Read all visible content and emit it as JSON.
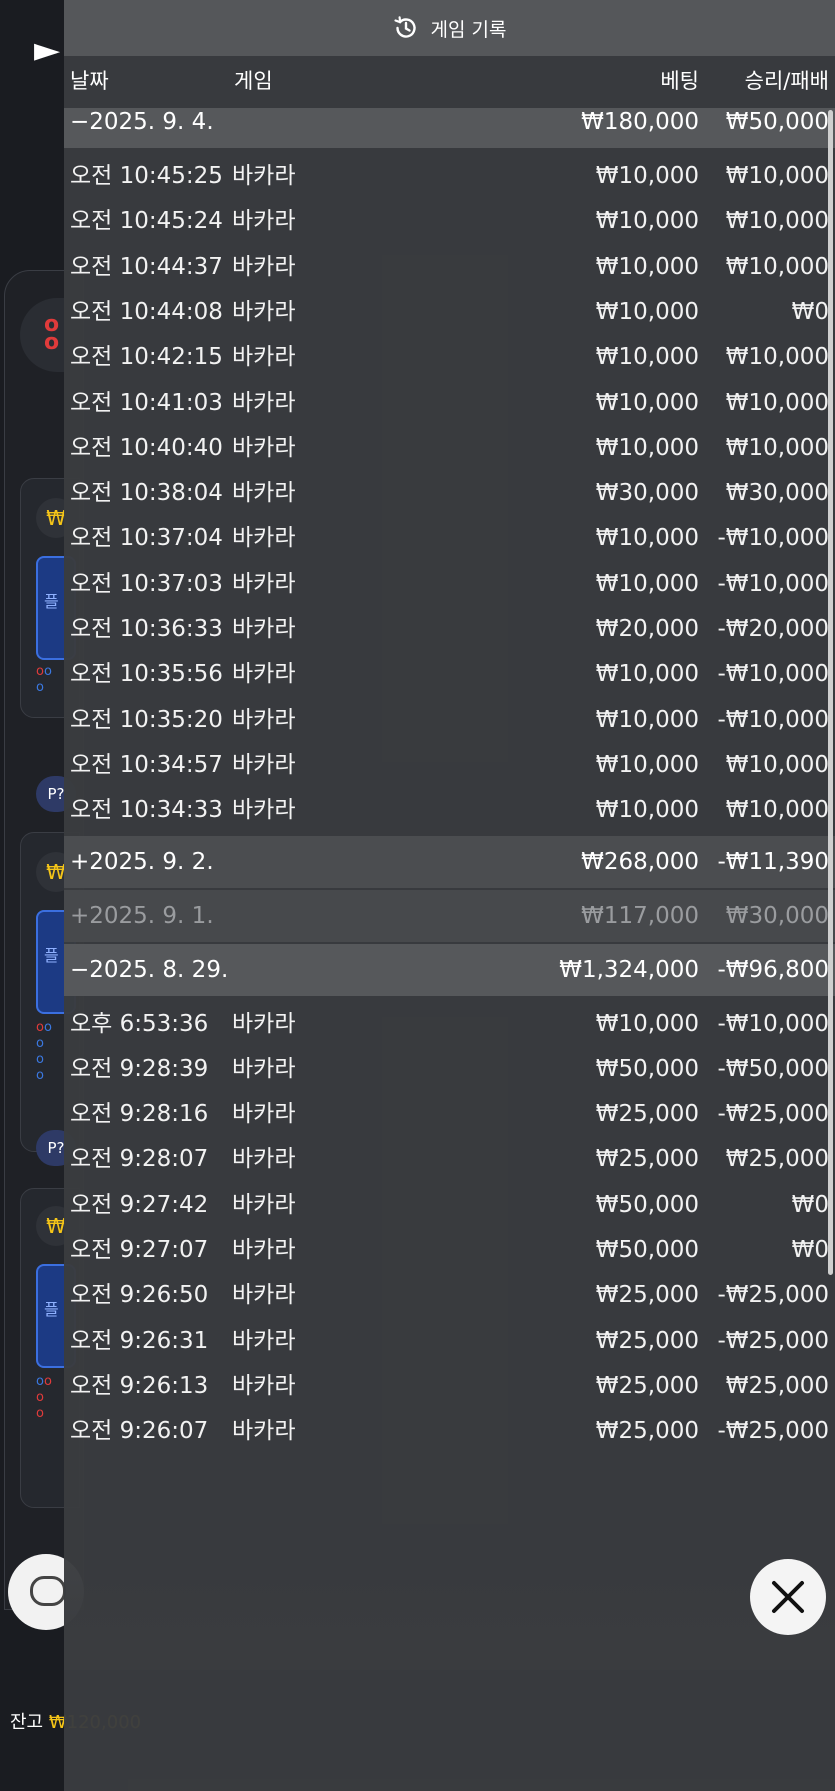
{
  "header": {
    "title": "게임 기록",
    "icon": "history-icon"
  },
  "columns": {
    "date": "날짜",
    "game": "게임",
    "bet": "베팅",
    "result": "승리/패배"
  },
  "groups": [
    {
      "toggle": "−",
      "date": "2025. 9. 4.",
      "label": "−2025. 9. 4.",
      "bet": "₩180,000",
      "result": "₩50,000",
      "expanded": true,
      "rows": [
        {
          "time": "오전 10:45:25",
          "game": "바카라",
          "bet": "₩10,000",
          "result": "₩10,000"
        },
        {
          "time": "오전 10:45:24",
          "game": "바카라",
          "bet": "₩10,000",
          "result": "₩10,000"
        },
        {
          "time": "오전 10:44:37",
          "game": "바카라",
          "bet": "₩10,000",
          "result": "₩10,000"
        },
        {
          "time": "오전 10:44:08",
          "game": "바카라",
          "bet": "₩10,000",
          "result": "₩0"
        },
        {
          "time": "오전 10:42:15",
          "game": "바카라",
          "bet": "₩10,000",
          "result": "₩10,000"
        },
        {
          "time": "오전 10:41:03",
          "game": "바카라",
          "bet": "₩10,000",
          "result": "₩10,000"
        },
        {
          "time": "오전 10:40:40",
          "game": "바카라",
          "bet": "₩10,000",
          "result": "₩10,000"
        },
        {
          "time": "오전 10:38:04",
          "game": "바카라",
          "bet": "₩30,000",
          "result": "₩30,000"
        },
        {
          "time": "오전 10:37:04",
          "game": "바카라",
          "bet": "₩10,000",
          "result": "-₩10,000"
        },
        {
          "time": "오전 10:37:03",
          "game": "바카라",
          "bet": "₩10,000",
          "result": "-₩10,000"
        },
        {
          "time": "오전 10:36:33",
          "game": "바카라",
          "bet": "₩20,000",
          "result": "-₩20,000"
        },
        {
          "time": "오전 10:35:56",
          "game": "바카라",
          "bet": "₩10,000",
          "result": "-₩10,000"
        },
        {
          "time": "오전 10:35:20",
          "game": "바카라",
          "bet": "₩10,000",
          "result": "-₩10,000"
        },
        {
          "time": "오전 10:34:57",
          "game": "바카라",
          "bet": "₩10,000",
          "result": "₩10,000"
        },
        {
          "time": "오전 10:34:33",
          "game": "바카라",
          "bet": "₩10,000",
          "result": "₩10,000"
        }
      ]
    },
    {
      "toggle": "+",
      "label": "+2025. 9. 2.",
      "bet": "₩268,000",
      "result": "-₩11,390",
      "expanded": false
    },
    {
      "toggle": "+",
      "label": "+2025. 9. 1.",
      "bet": "₩117,000",
      "result": "₩30,000",
      "expanded": false
    },
    {
      "toggle": "−",
      "label": "−2025. 8. 29.",
      "bet": "₩1,324,000",
      "result": "-₩96,800",
      "expanded": true,
      "rows": [
        {
          "time": "오후 6:53:36",
          "game": "바카라",
          "bet": "₩10,000",
          "result": "-₩10,000"
        },
        {
          "time": "오전 9:28:39",
          "game": "바카라",
          "bet": "₩50,000",
          "result": "-₩50,000"
        },
        {
          "time": "오전 9:28:16",
          "game": "바카라",
          "bet": "₩25,000",
          "result": "-₩25,000"
        },
        {
          "time": "오전 9:28:07",
          "game": "바카라",
          "bet": "₩25,000",
          "result": "₩25,000"
        },
        {
          "time": "오전 9:27:42",
          "game": "바카라",
          "bet": "₩50,000",
          "result": "₩0"
        },
        {
          "time": "오전 9:27:07",
          "game": "바카라",
          "bet": "₩50,000",
          "result": "₩0"
        },
        {
          "time": "오전 9:26:50",
          "game": "바카라",
          "bet": "₩25,000",
          "result": "-₩25,000"
        },
        {
          "time": "오전 9:26:31",
          "game": "바카라",
          "bet": "₩25,000",
          "result": "-₩25,000"
        },
        {
          "time": "오전 9:26:13",
          "game": "바카라",
          "bet": "₩25,000",
          "result": "₩25,000"
        },
        {
          "time": "오전 9:26:07",
          "game": "바카라",
          "bet": "₩25,000",
          "result": "-₩25,000"
        }
      ]
    }
  ],
  "background": {
    "balance_label": "잔고",
    "balance_value": "₩120,000",
    "coin_symbol": "₩",
    "blue_label": "플",
    "pq_label": "P?"
  },
  "close_button": {
    "icon": "close-icon"
  }
}
